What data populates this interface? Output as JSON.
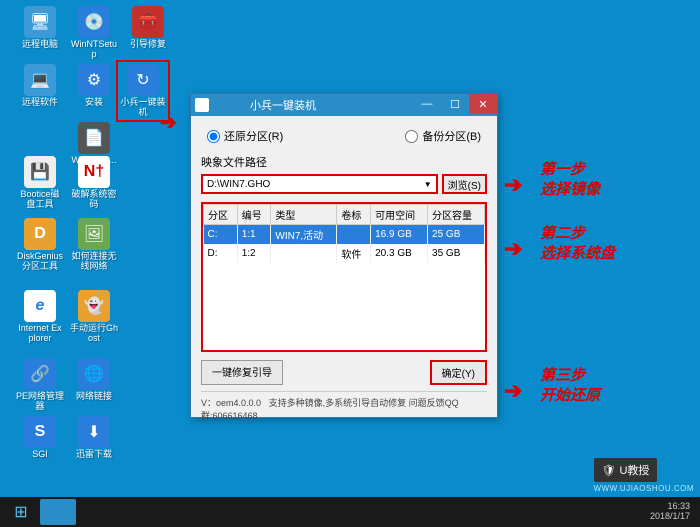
{
  "desktop": {
    "icons": [
      {
        "label": "远程电脑",
        "bg": "#3a9bd8",
        "glyph": "🖥"
      },
      {
        "label": "WinNTSetup",
        "bg": "#2a7edb",
        "glyph": "📀"
      },
      {
        "label": "引导修复",
        "bg": "#c23030",
        "glyph": "🧰"
      },
      {
        "label": "远程软件",
        "bg": "#3a9bd8",
        "glyph": "💻"
      },
      {
        "label": "安装",
        "bg": "#2a7edb",
        "glyph": "⚙"
      },
      {
        "label": "小兵一键装机",
        "bg": "#2a7edb",
        "glyph": "🔄"
      },
      {
        "label": "WIN7_64...",
        "bg": "",
        "glyph": ""
      },
      {
        "label": "Bootice磁盘工具",
        "bg": "#eee",
        "glyph": "💾"
      },
      {
        "label": "破解系统密码",
        "bg": "#fff",
        "glyph": "🅽"
      },
      {
        "label": "DiskGenius分区工具",
        "bg": "#e8a030",
        "glyph": "D"
      },
      {
        "label": "如何连接无线网络",
        "bg": "#6aa",
        "glyph": "🖼"
      },
      {
        "label": "Internet Explorer",
        "bg": "#3a9bd8",
        "glyph": "e"
      },
      {
        "label": "手动运行Ghost",
        "bg": "#e8a030",
        "glyph": "👻"
      },
      {
        "label": "PE网络管理器",
        "bg": "#2a7edb",
        "glyph": "🔗"
      },
      {
        "label": "网络链接",
        "bg": "#2a7edb",
        "glyph": "🌐"
      },
      {
        "label": "SGI",
        "bg": "#2a7edb",
        "glyph": "S"
      },
      {
        "label": "迅雷下载",
        "bg": "#2a7edb",
        "glyph": "⬇"
      }
    ]
  },
  "window": {
    "title": "小兵一键装机",
    "radio_restore": "还原分区(R)",
    "radio_backup": "备份分区(B)",
    "path_label": "映象文件路径",
    "path_value": "D:\\WIN7.GHO",
    "browse": "浏览(S)",
    "headers": [
      "分区",
      "编号",
      "类型",
      "卷标",
      "可用空间",
      "分区容量"
    ],
    "rows": [
      {
        "p": "C:",
        "n": "1:1",
        "t": "WIN7,活动",
        "v": "",
        "free": "16.9 GB",
        "cap": "25 GB",
        "sel": true
      },
      {
        "p": "D:",
        "n": "1:2",
        "t": "",
        "v": "软件",
        "free": "20.3 GB",
        "cap": "35 GB",
        "sel": false
      }
    ],
    "btn_repair": "一键修复引导",
    "btn_ok": "确定(Y)",
    "status_ver": "V：oem4.0.0.0",
    "status_msg": "支持多种镜像,多系统引导自动修复 问题反馈QQ群:606616468"
  },
  "annot": {
    "s1a": "第一步",
    "s1b": "选择镜像",
    "s2a": "第二步",
    "s2b": "选择系统盘",
    "s3a": "第三步",
    "s3b": "开始还原"
  },
  "taskbar": {
    "time": "16:33",
    "date": "2018/1/17"
  },
  "watermark": {
    "brand": "U教授",
    "url": "WWW.UJIAOSHOU.COM"
  }
}
